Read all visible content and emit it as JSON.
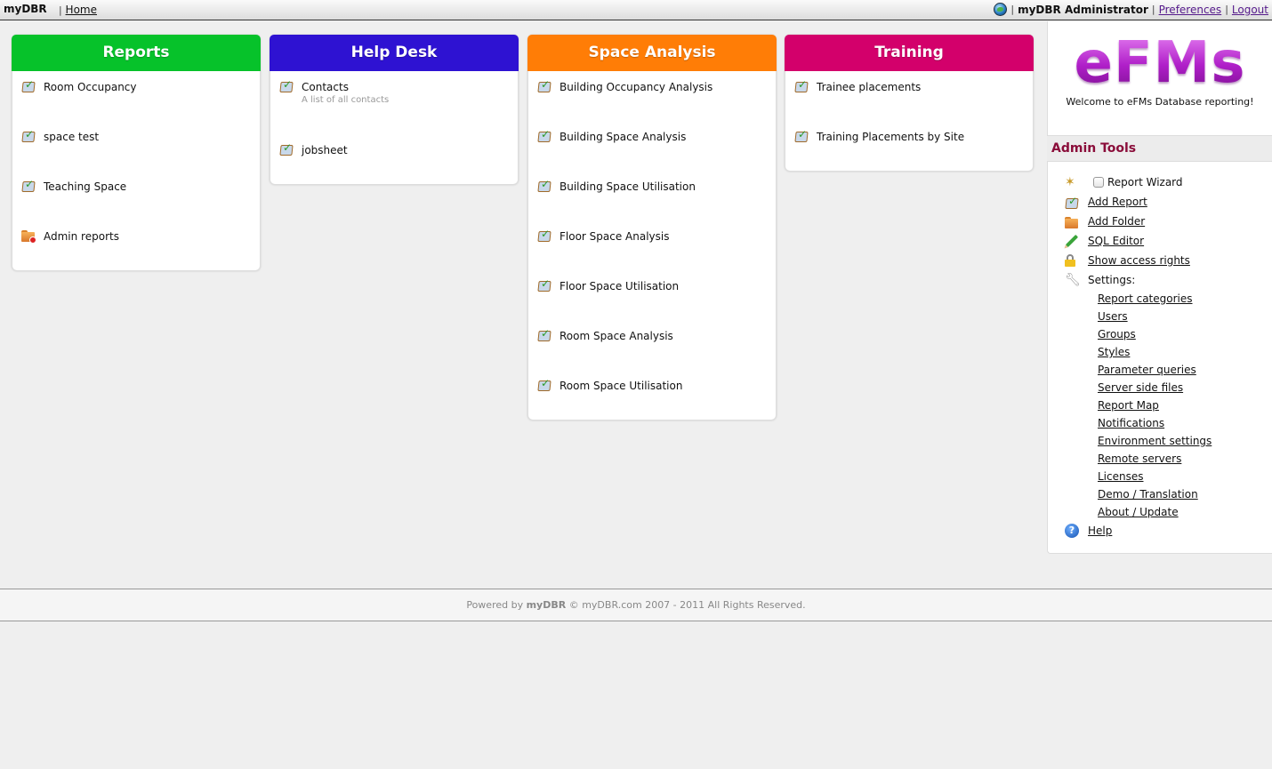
{
  "topbar": {
    "brand": "myDBR",
    "separator": "|",
    "home": "Home",
    "user": "myDBR Administrator",
    "preferences": "Preferences",
    "logout": "Logout"
  },
  "categories": [
    {
      "title": "Reports",
      "color": "#06c22a",
      "items": [
        {
          "label": "Room Occupancy",
          "icon": "report-icon"
        },
        {
          "label": "space test",
          "icon": "report-icon"
        },
        {
          "label": "Teaching Space",
          "icon": "report-icon"
        },
        {
          "label": "Admin reports",
          "icon": "locked-folder-icon"
        }
      ]
    },
    {
      "title": "Help Desk",
      "color": "#2e12d2",
      "items": [
        {
          "label": "Contacts",
          "description": "A list of all contacts",
          "icon": "report-icon"
        },
        {
          "label": "jobsheet",
          "icon": "report-icon"
        }
      ]
    },
    {
      "title": "Space Analysis",
      "color": "#ff7d06",
      "items": [
        {
          "label": "Building Occupancy Analysis",
          "icon": "report-icon"
        },
        {
          "label": "Building Space Analysis",
          "icon": "report-icon"
        },
        {
          "label": "Building Space Utilisation",
          "icon": "report-icon"
        },
        {
          "label": "Floor Space Analysis",
          "icon": "report-icon"
        },
        {
          "label": "Floor Space Utilisation",
          "icon": "report-icon"
        },
        {
          "label": "Room Space Analysis",
          "icon": "report-icon"
        },
        {
          "label": "Room Space Utilisation",
          "icon": "report-icon"
        }
      ]
    },
    {
      "title": "Training",
      "color": "#d3006b",
      "items": [
        {
          "label": "Trainee placements",
          "icon": "report-icon"
        },
        {
          "label": "Training Placements by Site",
          "icon": "report-icon"
        }
      ]
    }
  ],
  "welcome": {
    "logo": "eFMs",
    "message": "Welcome to eFMs Database reporting!"
  },
  "admin_tools": {
    "title": "Admin Tools",
    "report_wizard": "Report Wizard",
    "report_wizard_checked": false,
    "add_report": "Add Report",
    "add_folder": "Add Folder",
    "sql_editor": "SQL Editor",
    "show_access_rights": "Show access rights",
    "settings_label": "Settings:",
    "settings": [
      "Report categories",
      "Users",
      "Groups",
      "Styles",
      "Parameter queries",
      "Server side files",
      "Report Map",
      "Notifications",
      "Environment settings",
      "Remote servers",
      "Licenses",
      "Demo / Translation",
      "About / Update"
    ],
    "help": "Help"
  },
  "footer": {
    "prefix": "Powered by ",
    "brand": "myDBR",
    "suffix": " © myDBR.com 2007 - 2011 All Rights Reserved."
  }
}
